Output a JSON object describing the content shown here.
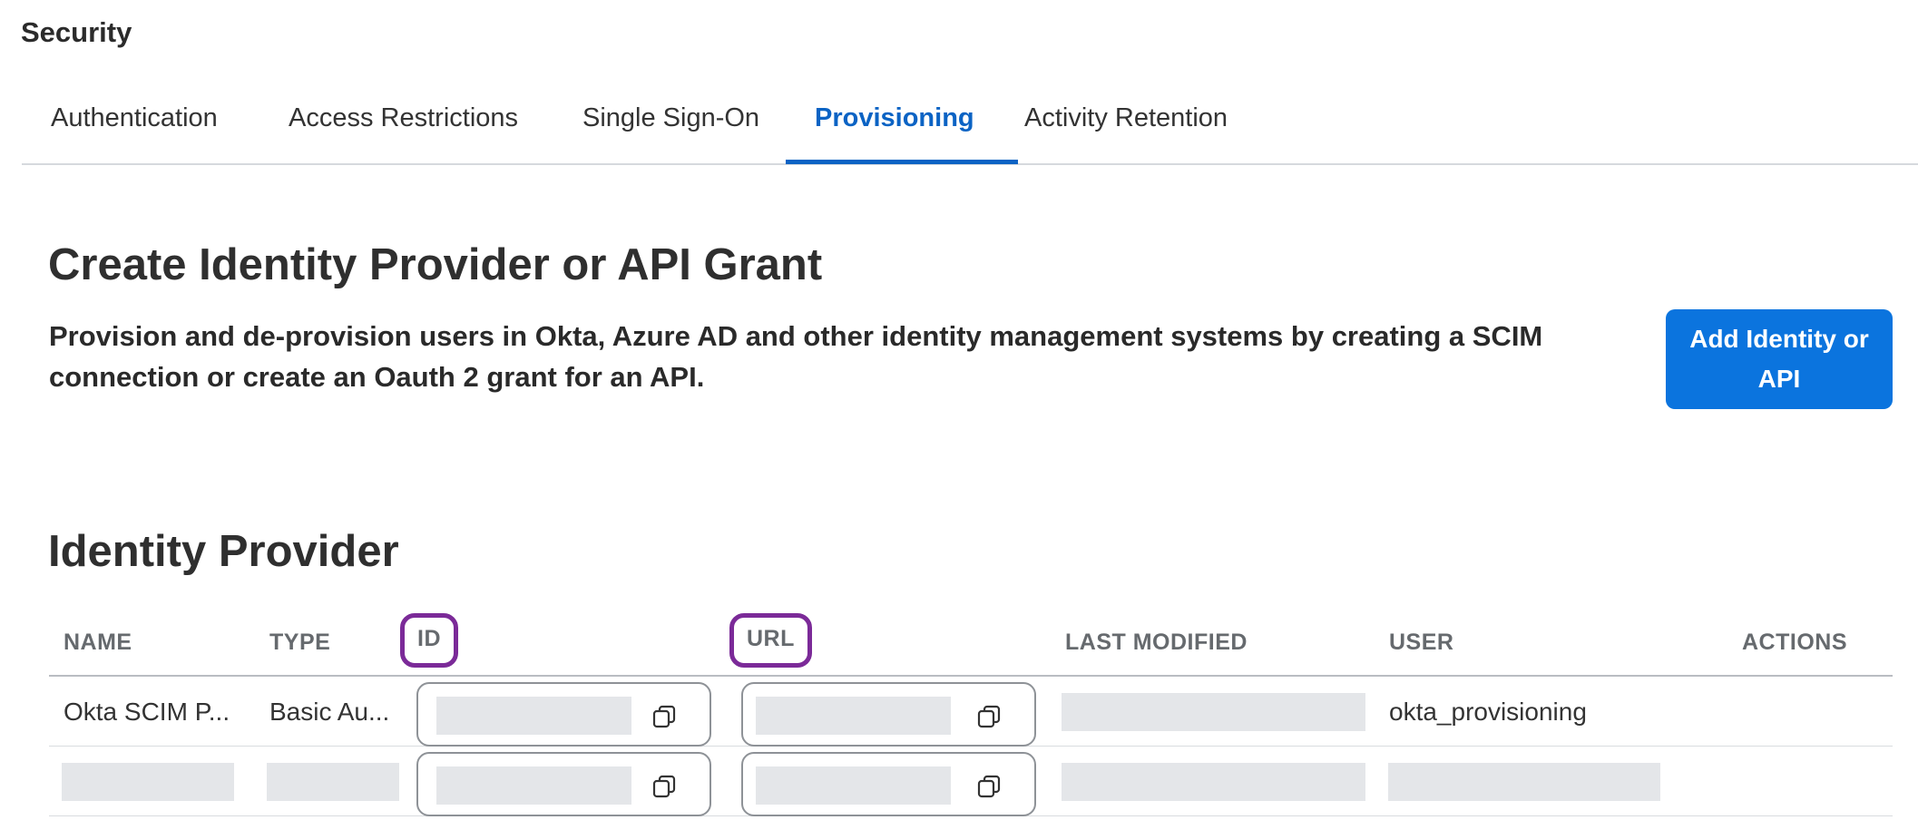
{
  "page": {
    "title": "Security"
  },
  "tabs": [
    {
      "label": "Authentication"
    },
    {
      "label": "Access Restrictions"
    },
    {
      "label": "Single Sign-On"
    },
    {
      "label": "Provisioning",
      "active": true
    },
    {
      "label": "Activity Retention"
    }
  ],
  "create_section": {
    "title": "Create Identity Provider or API Grant",
    "description": "Provision and de-provision users in Okta, Azure AD and other identity management systems by creating a SCIM connection or create an Oauth 2 grant for an API.",
    "add_button_label": "Add Identity or API"
  },
  "identity_provider": {
    "title": "Identity Provider",
    "columns": [
      "NAME",
      "TYPE",
      "ID",
      "URL",
      "LAST MODIFIED",
      "USER",
      "ACTIONS"
    ],
    "highlighted_columns": [
      "ID",
      "URL"
    ],
    "rows": [
      {
        "name": "Okta SCIM P...",
        "type": "Basic Au...",
        "id": "",
        "url": "",
        "last_modified": "",
        "user": "okta_provisioning"
      },
      {
        "name": "",
        "type": "",
        "id": "",
        "url": "",
        "last_modified": "",
        "user": ""
      }
    ]
  },
  "colors": {
    "accent": "#0b63c4",
    "button": "#0b74de",
    "highlight_outline": "#7b2a98",
    "placeholder": "#e4e6e9"
  },
  "icons": {
    "copy": "copy-icon"
  }
}
